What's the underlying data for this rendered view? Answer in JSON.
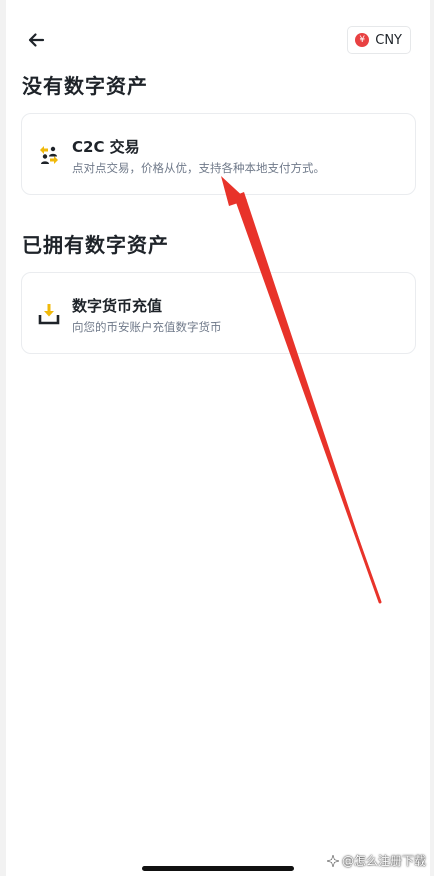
{
  "header": {
    "back_icon": "arrow-left-icon",
    "currency_symbol": "¥",
    "currency_label": "CNY",
    "currency_color": "#e84142"
  },
  "sections": [
    {
      "title": "没有数字资产",
      "card": {
        "icon": "users-exchange-icon",
        "title": "C2C 交易",
        "description": "点对点交易，价格从优，支持各种本地支付方式。"
      }
    },
    {
      "title": "已拥有数字资产",
      "card": {
        "icon": "deposit-icon",
        "title": "数字货币充值",
        "description": "向您的币安账户充值数字货币"
      }
    }
  ],
  "annotation": {
    "arrow_color": "#e8332a"
  },
  "watermark": {
    "text": "@怎么注册下载"
  },
  "colors": {
    "brand_yellow": "#f0b90b",
    "text_primary": "#1e2329",
    "text_secondary": "#707a8a"
  }
}
